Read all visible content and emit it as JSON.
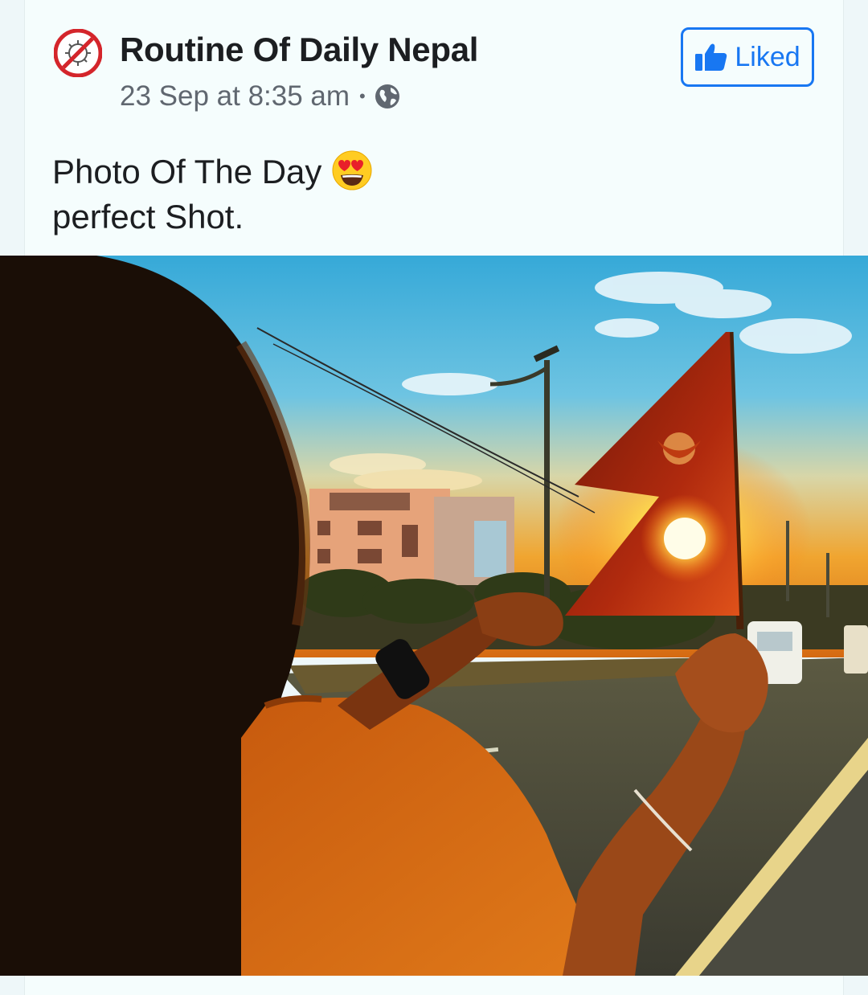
{
  "post": {
    "page_name": "Routine Of Daily Nepal",
    "timestamp": "23 Sep at 8:35 am",
    "separator": "•",
    "privacy_icon": "globe-icon",
    "avatar_icon": "no-virus-icon",
    "liked_label": "Liked",
    "like_icon": "thumbs-up-icon",
    "text_line1": "Photo Of The Day",
    "text_line1_emoji": "heart-eyes-emoji",
    "text_line2": "perfect Shot.",
    "photo_description_icon": "nepal-flag-sunset-photo"
  },
  "colors": {
    "accent": "#1877f2",
    "name_text": "#1c1e21",
    "meta_text": "#606770",
    "card_bg": "#f5fdfd"
  }
}
